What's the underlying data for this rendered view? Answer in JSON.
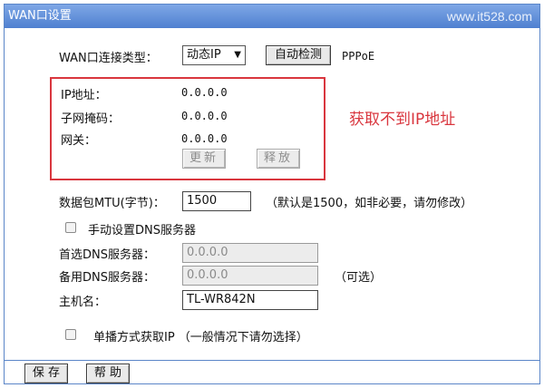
{
  "window": {
    "title": "WAN口设置",
    "watermark": "www.it528.com"
  },
  "connection": {
    "label": "WAN口连接类型：",
    "selected": "动态IP",
    "detect_label": "自动检测",
    "extra_option": "PPPoE"
  },
  "ipinfo": {
    "ip_label": "IP地址：",
    "ip_value": "0.0.0.0",
    "mask_label": "子网掩码：",
    "mask_value": "0.0.0.0",
    "gateway_label": "网关：",
    "gateway_value": "0.0.0.0",
    "renew_label": "更新",
    "release_label": "释放"
  },
  "annotation": {
    "text": "获取不到IP地址",
    "color": "#d9363e"
  },
  "mtu": {
    "label": "数据包MTU(字节)：",
    "value": "1500",
    "hint": "（默认是1500，如非必要，请勿修改）"
  },
  "dns": {
    "manual_label": "手动设置DNS服务器",
    "primary_label": "首选DNS服务器：",
    "primary_value": "0.0.0.0",
    "secondary_label": "备用DNS服务器：",
    "secondary_value": "0.0.0.0",
    "optional_hint": "（可选）"
  },
  "host": {
    "label": "主机名：",
    "value": "TL-WR842N"
  },
  "unicast": {
    "label": "单播方式获取IP （一般情况下请勿选择）"
  },
  "footer": {
    "save_label": "保 存",
    "help_label": "帮 助"
  },
  "colors": {
    "title_bar": "#4f80d0",
    "border": "#5b86c8"
  }
}
